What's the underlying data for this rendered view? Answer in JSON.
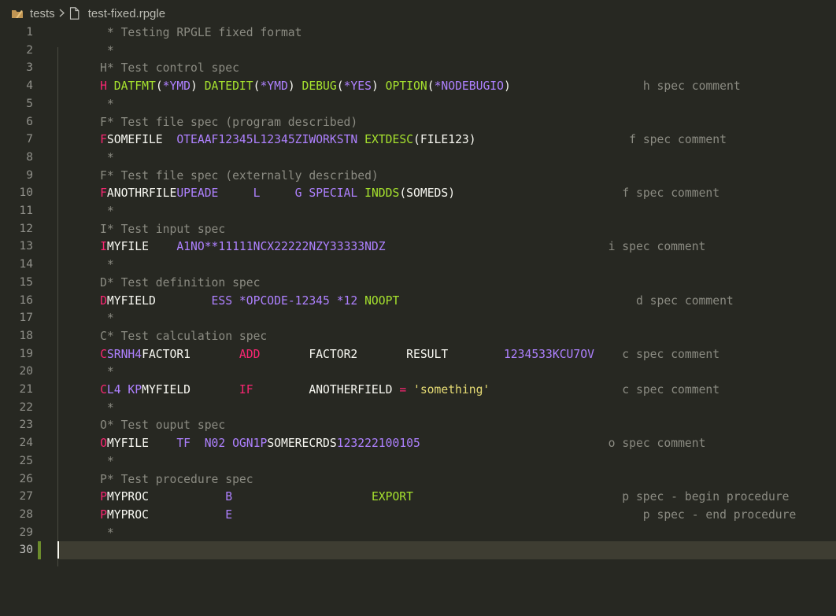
{
  "breadcrumb": {
    "folder": "tests",
    "file": "test-fixed.rpgle"
  },
  "colors": {
    "default": "#f8f8f2",
    "comment": "#8b8b82",
    "keyword": "#f92672",
    "purple": "#ae81ff",
    "green": "#a6e22e",
    "string": "#e6db74"
  },
  "editor": {
    "current_line": 30,
    "lines": [
      [
        [
          "       * Testing RPGLE fixed format",
          "c"
        ]
      ],
      [
        [
          "       *",
          "c"
        ]
      ],
      [
        [
          "      H* Test control spec",
          "c"
        ]
      ],
      [
        [
          "      ",
          ""
        ],
        [
          "H",
          "k"
        ],
        [
          " ",
          ""
        ],
        [
          "DATFMT",
          "g"
        ],
        [
          "(",
          ""
        ],
        [
          "*YMD",
          "p"
        ],
        [
          ")",
          ""
        ],
        [
          " ",
          ""
        ],
        [
          "DATEDIT",
          "g"
        ],
        [
          "(",
          ""
        ],
        [
          "*YMD",
          "p"
        ],
        [
          ")",
          ""
        ],
        [
          " ",
          ""
        ],
        [
          "DEBUG",
          "g"
        ],
        [
          "(",
          ""
        ],
        [
          "*YES",
          "p"
        ],
        [
          ")",
          ""
        ],
        [
          " ",
          ""
        ],
        [
          "OPTION",
          "g"
        ],
        [
          "(",
          ""
        ],
        [
          "*NODEBUGIO",
          "p"
        ],
        [
          ")",
          ""
        ],
        [
          "                   ",
          ""
        ],
        [
          "h spec comment",
          "c"
        ]
      ],
      [
        [
          "       *",
          "c"
        ]
      ],
      [
        [
          "      F* Test file spec (program described)",
          "c"
        ]
      ],
      [
        [
          "      ",
          ""
        ],
        [
          "F",
          "k"
        ],
        [
          "SOMEFILE  ",
          ""
        ],
        [
          "OTEAAF12345L12345ZIWORKSTN",
          "p"
        ],
        [
          " ",
          ""
        ],
        [
          "EXTDESC",
          "g"
        ],
        [
          "(FILE123)",
          ""
        ],
        [
          "                      ",
          ""
        ],
        [
          "f spec comment",
          "c"
        ]
      ],
      [
        [
          "       *",
          "c"
        ]
      ],
      [
        [
          "      F* Test file spec (externally described)",
          "c"
        ]
      ],
      [
        [
          "      ",
          ""
        ],
        [
          "F",
          "k"
        ],
        [
          "ANOTHRFILE",
          ""
        ],
        [
          "UPEADE     L     G SPECIAL",
          "p"
        ],
        [
          " ",
          ""
        ],
        [
          "INDDS",
          "g"
        ],
        [
          "(SOMEDS)",
          ""
        ],
        [
          "                        ",
          ""
        ],
        [
          "f spec comment",
          "c"
        ]
      ],
      [
        [
          "       *",
          "c"
        ]
      ],
      [
        [
          "      I* Test input spec",
          "c"
        ]
      ],
      [
        [
          "      ",
          ""
        ],
        [
          "I",
          "k"
        ],
        [
          "MYFILE    ",
          ""
        ],
        [
          "A1NO**11111NCX22222NZY33333NDZ",
          "p"
        ],
        [
          "                                ",
          ""
        ],
        [
          "i spec comment",
          "c"
        ]
      ],
      [
        [
          "       *",
          "c"
        ]
      ],
      [
        [
          "      D* Test definition spec",
          "c"
        ]
      ],
      [
        [
          "      ",
          ""
        ],
        [
          "D",
          "k"
        ],
        [
          "MYFIELD        ",
          ""
        ],
        [
          "ESS *OPCODE-12345 *12",
          "p"
        ],
        [
          " ",
          ""
        ],
        [
          "NOOPT",
          "g"
        ],
        [
          "                                  ",
          ""
        ],
        [
          "d spec comment",
          "c"
        ]
      ],
      [
        [
          "       *",
          "c"
        ]
      ],
      [
        [
          "      C* Test calculation spec",
          "c"
        ]
      ],
      [
        [
          "      ",
          ""
        ],
        [
          "C",
          "k"
        ],
        [
          "SRNH4",
          "p"
        ],
        [
          "FACTOR1       ",
          ""
        ],
        [
          "ADD",
          "k"
        ],
        [
          "       FACTOR2       RESULT        ",
          ""
        ],
        [
          "1234533KCU7OV",
          "p"
        ],
        [
          "    ",
          ""
        ],
        [
          "c spec comment",
          "c"
        ]
      ],
      [
        [
          "       *",
          "c"
        ]
      ],
      [
        [
          "      ",
          ""
        ],
        [
          "C",
          "k"
        ],
        [
          "L4 KP",
          "p"
        ],
        [
          "MYFIELD       ",
          ""
        ],
        [
          "IF",
          "k"
        ],
        [
          "        ANOTHERFIELD ",
          ""
        ],
        [
          "=",
          "k"
        ],
        [
          " ",
          ""
        ],
        [
          "'something'",
          "s"
        ],
        [
          "                   ",
          ""
        ],
        [
          "c spec comment",
          "c"
        ]
      ],
      [
        [
          "       *",
          "c"
        ]
      ],
      [
        [
          "      O* Test ouput spec",
          "c"
        ]
      ],
      [
        [
          "      ",
          ""
        ],
        [
          "O",
          "k"
        ],
        [
          "MYFILE    ",
          ""
        ],
        [
          "TF  N02 OGN1P",
          "p"
        ],
        [
          "SOMERECRDS",
          ""
        ],
        [
          "123222100105",
          "p"
        ],
        [
          "                           ",
          ""
        ],
        [
          "o spec comment",
          "c"
        ]
      ],
      [
        [
          "       *",
          "c"
        ]
      ],
      [
        [
          "      P* Test procedure spec",
          "c"
        ]
      ],
      [
        [
          "      ",
          ""
        ],
        [
          "P",
          "k"
        ],
        [
          "MYPROC           ",
          ""
        ],
        [
          "B",
          "p"
        ],
        [
          "                    ",
          ""
        ],
        [
          "EXPORT",
          "g"
        ],
        [
          "                              ",
          ""
        ],
        [
          "p spec - begin procedure",
          "c"
        ]
      ],
      [
        [
          "      ",
          ""
        ],
        [
          "P",
          "k"
        ],
        [
          "MYPROC           ",
          ""
        ],
        [
          "E",
          "p"
        ],
        [
          "                                                           ",
          ""
        ],
        [
          "p spec - end procedure",
          "c"
        ]
      ],
      [
        [
          "       *",
          "c"
        ]
      ],
      []
    ]
  }
}
